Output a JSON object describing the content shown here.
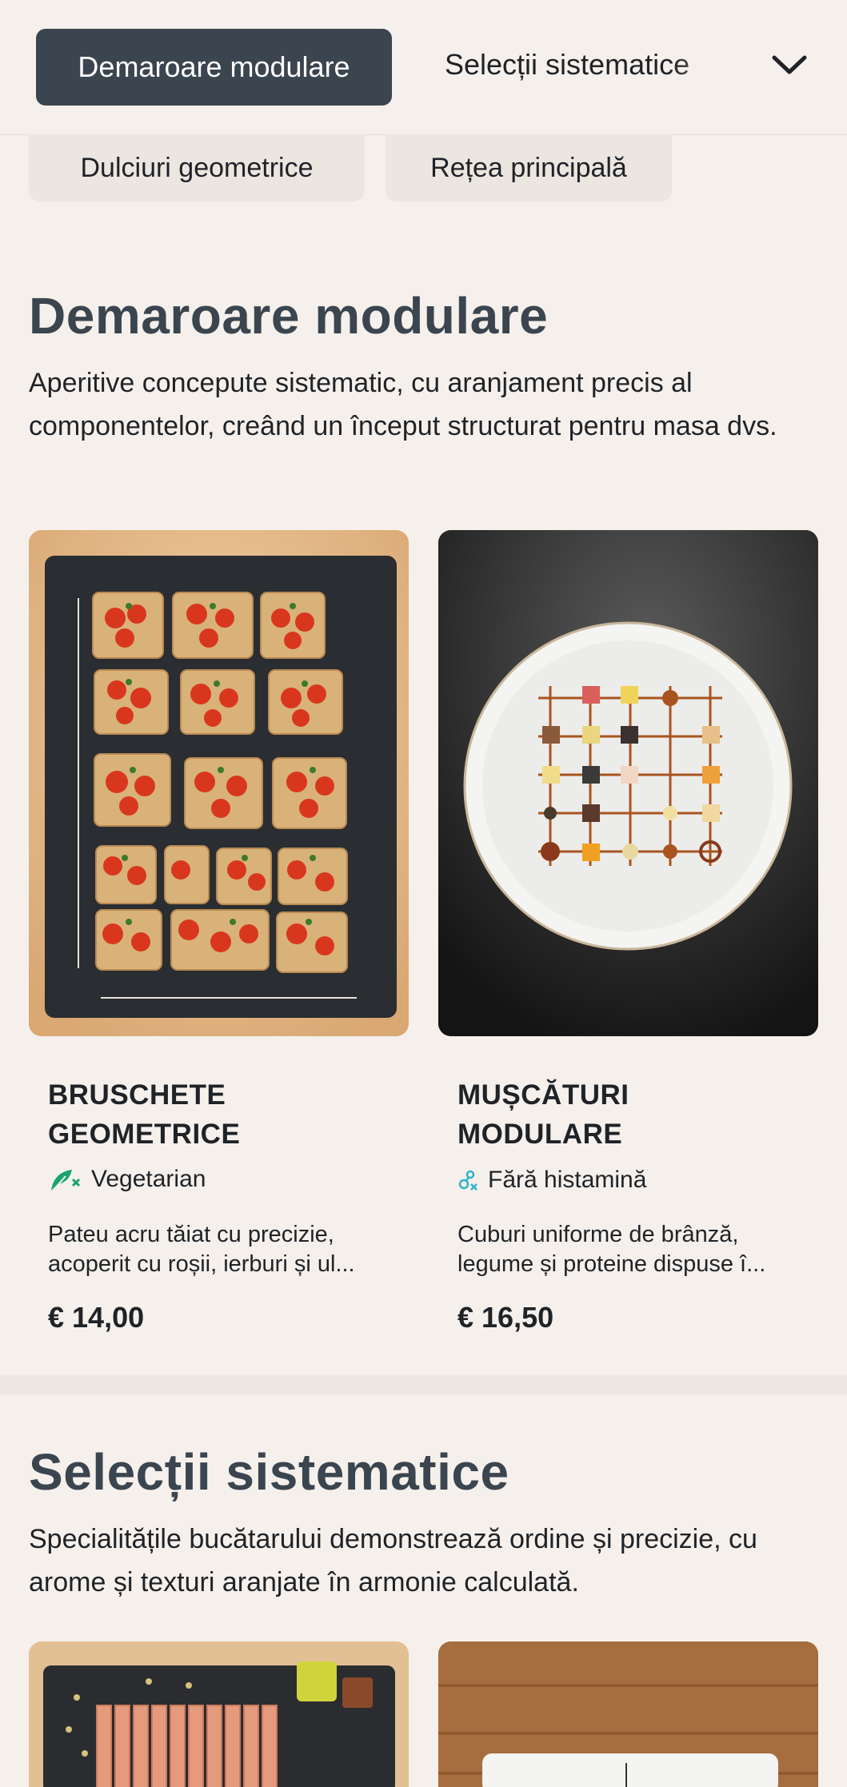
{
  "nav": {
    "active_tab": "Demaroare modulare",
    "next_tab": "Selecții sistematice",
    "pills": [
      "Dulciuri geometrice",
      "Rețea principală"
    ]
  },
  "sections": [
    {
      "title": "Demaroare modulare",
      "description": "Aperitive concepute sistematic, cu aranjament precis al componentelor, creând un început structurat pentru masa dvs.",
      "items": [
        {
          "title_line1": "BRUSCHETE",
          "title_line2": "GEOMETRICE",
          "tag": "Vegetarian",
          "description_line1": "Pateu acru tăiat cu precizie,",
          "description_line2": "acoperit cu roșii, ierburi și ul...",
          "price": "€ 14,00"
        },
        {
          "title_line1": "MUȘCĂTURI",
          "title_line2": "MODULARE",
          "tag": "Fără histamină",
          "description_line1": "Cuburi uniforme de brânză,",
          "description_line2": "legume și proteine dispuse î...",
          "price": "€ 16,50"
        }
      ]
    },
    {
      "title": "Selecții sistematice",
      "description": "Specialitățile bucătarului demonstrează ordine și precizie, cu arome și texturi aranjate în armonie calculată."
    }
  ],
  "icons": {
    "chevron": "chevron-down-icon",
    "vegetarian": "vegetarian-icon",
    "histamine_free": "histamine-free-icon"
  },
  "colors": {
    "background": "#f5f0eb",
    "accent": "#3b4550",
    "vegetarian_tag": "#1aa46b",
    "histamine_tag": "#2fb3c9"
  }
}
